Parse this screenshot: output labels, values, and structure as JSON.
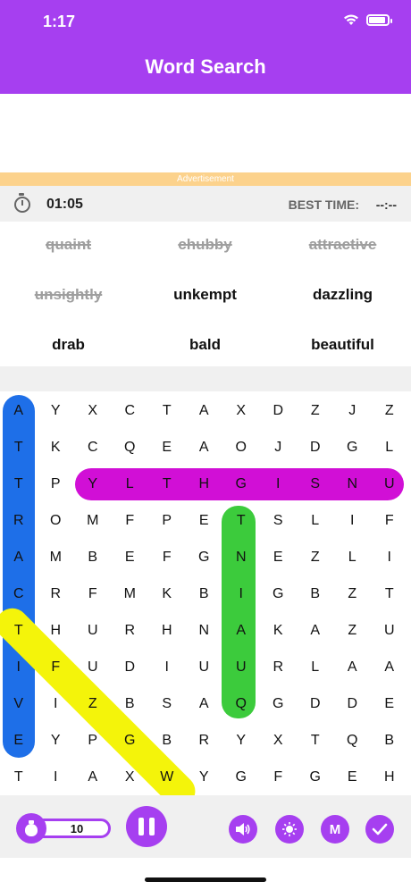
{
  "status_bar": {
    "time": "1:17"
  },
  "header": {
    "title": "Word Search"
  },
  "ad": {
    "label": "Advertisement"
  },
  "timer": {
    "elapsed": "01:05",
    "best_label": "BEST TIME:",
    "best_value": "--:--"
  },
  "words": [
    {
      "text": "quaint",
      "found": true
    },
    {
      "text": "chubby",
      "found": true
    },
    {
      "text": "attractive",
      "found": true
    },
    {
      "text": "unsightly",
      "found": true
    },
    {
      "text": "unkempt",
      "found": false
    },
    {
      "text": "dazzling",
      "found": false
    },
    {
      "text": "drab",
      "found": false
    },
    {
      "text": "bald",
      "found": false
    },
    {
      "text": "beautiful",
      "found": false
    }
  ],
  "grid": [
    [
      "A",
      "Y",
      "X",
      "C",
      "T",
      "A",
      "X",
      "D",
      "Z",
      "J",
      "Z"
    ],
    [
      "T",
      "K",
      "C",
      "Q",
      "E",
      "A",
      "O",
      "J",
      "D",
      "G",
      "L"
    ],
    [
      "T",
      "P",
      "Y",
      "L",
      "T",
      "H",
      "G",
      "I",
      "S",
      "N",
      "U"
    ],
    [
      "R",
      "O",
      "M",
      "F",
      "P",
      "E",
      "T",
      "S",
      "L",
      "I",
      "F"
    ],
    [
      "A",
      "M",
      "B",
      "E",
      "F",
      "G",
      "N",
      "E",
      "Z",
      "L",
      "I"
    ],
    [
      "C",
      "R",
      "F",
      "M",
      "K",
      "B",
      "I",
      "G",
      "B",
      "Z",
      "T"
    ],
    [
      "T",
      "H",
      "U",
      "R",
      "H",
      "N",
      "A",
      "K",
      "A",
      "Z",
      "U"
    ],
    [
      "I",
      "F",
      "U",
      "D",
      "I",
      "U",
      "U",
      "R",
      "L",
      "A",
      "A"
    ],
    [
      "V",
      "I",
      "Z",
      "B",
      "S",
      "A",
      "Q",
      "G",
      "D",
      "D",
      "E"
    ],
    [
      "E",
      "Y",
      "P",
      "G",
      "B",
      "R",
      "Y",
      "X",
      "T",
      "Q",
      "B"
    ],
    [
      "T",
      "I",
      "A",
      "X",
      "W",
      "Y",
      "G",
      "F",
      "G",
      "E",
      "H"
    ]
  ],
  "highlight_colors": {
    "attractive": "#1e6fe8",
    "unsightly": "#d10fd6",
    "quaint": "#3ccb3c",
    "chubby": "#f4f40a"
  },
  "toolbar": {
    "coins": "10",
    "icons": [
      "coin-bag-icon",
      "pause-icon",
      "sound-icon",
      "hint-bulb-icon",
      "magnet-icon",
      "check-icon"
    ],
    "accent": "#a63ff0"
  }
}
